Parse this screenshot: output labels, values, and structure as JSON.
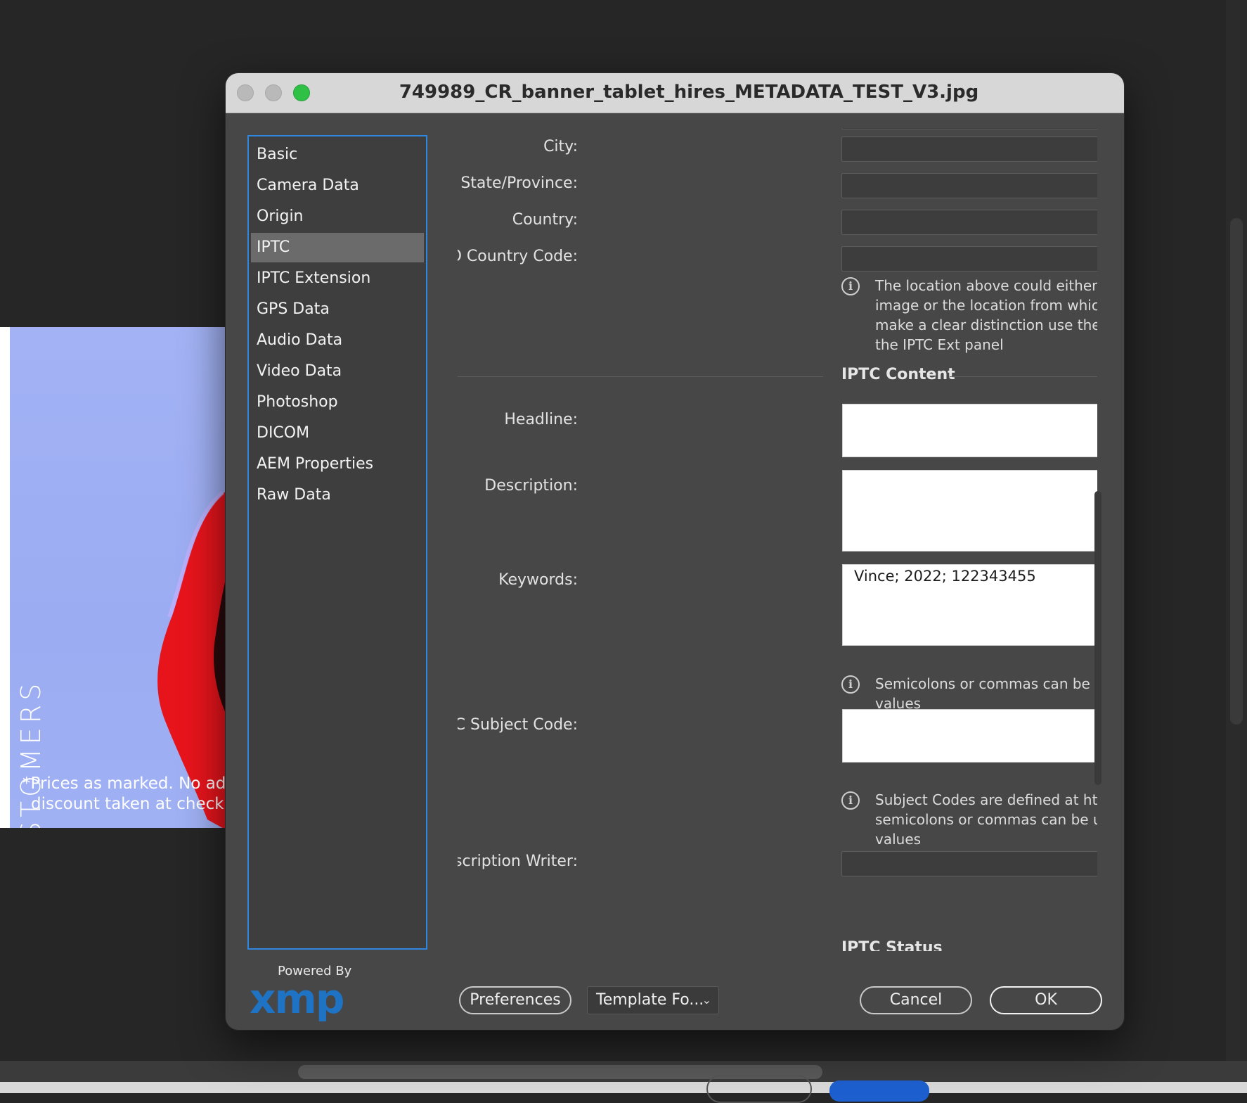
{
  "window": {
    "title": "749989_CR_banner_tablet_hires_METADATA_TEST_V3.jpg"
  },
  "background": {
    "banner_vertical_text": "FOR TOP CUSTOMERS",
    "banner_fine_print_line1": "*Prices as marked. No ad",
    "banner_fine_print_line2": "discount taken at check"
  },
  "sidebar": {
    "items": [
      {
        "label": "Basic",
        "selected": false
      },
      {
        "label": "Camera Data",
        "selected": false
      },
      {
        "label": "Origin",
        "selected": false
      },
      {
        "label": "IPTC",
        "selected": true
      },
      {
        "label": "IPTC Extension",
        "selected": false
      },
      {
        "label": "GPS Data",
        "selected": false
      },
      {
        "label": "Audio Data",
        "selected": false
      },
      {
        "label": "Video Data",
        "selected": false
      },
      {
        "label": "Photoshop",
        "selected": false
      },
      {
        "label": "DICOM",
        "selected": false
      },
      {
        "label": "AEM Properties",
        "selected": false
      },
      {
        "label": "Raw Data",
        "selected": false
      }
    ]
  },
  "form": {
    "labels": {
      "city": "City:",
      "state": "State/Province:",
      "country": "Country:",
      "iso": "ISO Country Code:",
      "headline": "Headline:",
      "description": "Description:",
      "keywords": "Keywords:",
      "subject_code": "IPTC Subject Code:",
      "description_writer": "Description Writer:"
    },
    "values": {
      "city": "",
      "state": "",
      "country": "",
      "iso": "",
      "headline": "",
      "description": "",
      "keywords": "Vince; 2022; 122343455",
      "subject_code": "",
      "description_writer": ""
    },
    "info": {
      "location": "The location above could either be the location shown in the image or the location from which the photo was taken. To make a clear distinction use the two Location properties on the IPTC Ext panel",
      "keywords": "Semicolons or commas can be used to separate multiple values",
      "subject_code": "Subject Codes are defined at http://www.newscodes.org, semicolons or commas can be used to separate multiple values"
    },
    "sections": {
      "content": "IPTC Content",
      "status": "IPTC Status"
    }
  },
  "footer": {
    "powered_by": "Powered By",
    "logo_text": "xmp",
    "preferences_label": "Preferences",
    "template_label": "Template Fo...",
    "cancel_label": "Cancel",
    "ok_label": "OK"
  },
  "icons": {
    "info": "info-circle-icon",
    "chevron": "chevron-down-icon"
  },
  "colors": {
    "accent": "#2f87e0",
    "xmp_logo": "#1f73c4",
    "zoom_button": "#2fc146"
  }
}
